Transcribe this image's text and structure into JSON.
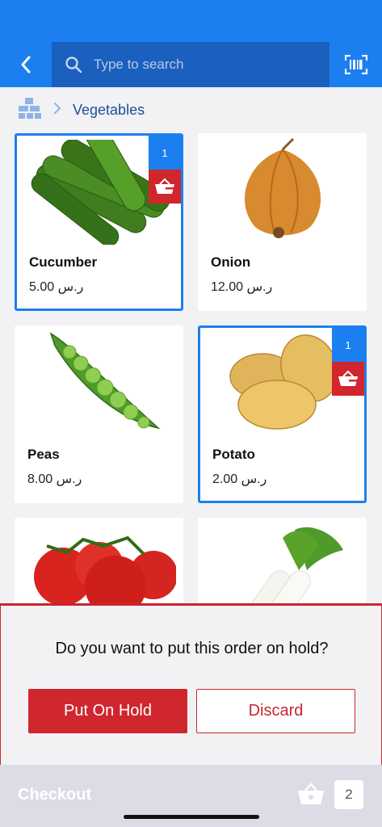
{
  "header": {
    "search_placeholder": "Type to search"
  },
  "breadcrumb": {
    "current": "Vegetables"
  },
  "products": [
    {
      "name": "Cucumber",
      "price": "5.00 ر.س",
      "quantity": "1",
      "selected": true,
      "image": "cucumber"
    },
    {
      "name": "Onion",
      "price": "12.00 ر.س",
      "quantity": "",
      "selected": false,
      "image": "onion"
    },
    {
      "name": "Peas",
      "price": "8.00 ر.س",
      "quantity": "",
      "selected": false,
      "image": "peas"
    },
    {
      "name": "Potato",
      "price": "2.00 ر.س",
      "quantity": "1",
      "selected": true,
      "image": "potato"
    },
    {
      "name": "",
      "price": "",
      "quantity": "",
      "selected": false,
      "image": "tomato"
    },
    {
      "name": "",
      "price": "",
      "quantity": "",
      "selected": false,
      "image": "radish"
    }
  ],
  "hold_dialog": {
    "question": "Do you want to put this order on hold?",
    "put_on_hold_label": "Put On Hold",
    "discard_label": "Discard"
  },
  "footer": {
    "checkout_label": "Checkout",
    "cart_count": "2"
  },
  "colors": {
    "primary": "#1c7ff0",
    "search_bg": "#1b5fbf",
    "danger": "#d0262e"
  }
}
